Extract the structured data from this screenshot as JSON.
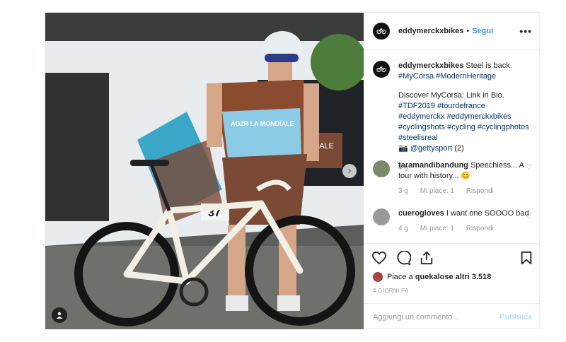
{
  "post": {
    "username": "eddymerckxbikes",
    "follow_label": "Segui",
    "more_label": "•••",
    "caption": {
      "username": "eddymerckxbikes",
      "text": "Steel is back.",
      "tags_line1": "#MyCorsa #ModernHeritage",
      "line2": "Discover MyCorsa: Link in Bio.",
      "tags_line3": "#TDF2019 #tourdefrance #eddymerckx #eddymerckxbikes #cyclingshots #cycling #cyclingphotos #steelisreal",
      "camera_glyph": "📷",
      "credit_mention": "@gettysport",
      "credit_count": "(2)",
      "time": "4 g"
    },
    "comments": [
      {
        "username": "taramandibandung",
        "text": "Speechless... A tour with history... 😊",
        "time": "3 g",
        "likes": "Mi piace: 1",
        "reply": "Rispondi"
      },
      {
        "username": "cuerogloves",
        "text": "I want one SOOOO bad",
        "time": "4 g",
        "likes": "Mi piace: 1",
        "reply": "Rispondi"
      }
    ],
    "likes_text": "Piace a ",
    "likes_user": "quekalos",
    "likes_others": " e altri 3.518",
    "date": "4 GIORNI FA",
    "comment_placeholder": "Aggiungi un commento...",
    "publish_label": "Pubblica",
    "jersey_text": "AG2R LA MONDIALE",
    "bus_text": "LA MALE",
    "bib_number": "37",
    "icons": [
      "heart-icon",
      "comment-icon",
      "share-icon",
      "bookmark-icon",
      "user-tag-icon",
      "chevron-right-icon",
      "bike-logo-icon"
    ],
    "colors": {
      "link": "#003569",
      "follow": "#3897f0",
      "publish_disabled": "#b2dffc"
    }
  }
}
